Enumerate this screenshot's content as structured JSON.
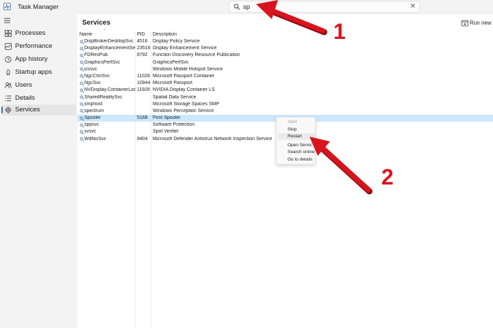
{
  "app": {
    "title": "Task Manager",
    "logo_icon": "task-manager-logo-icon"
  },
  "search": {
    "value": "sp",
    "icon": "search-icon",
    "clear_icon": "close-icon",
    "clear_glyph": "✕"
  },
  "sidebar": {
    "menu_icon": "hamburger-menu-icon",
    "items": [
      {
        "label": "Processes",
        "icon": "processes-icon",
        "active": false
      },
      {
        "label": "Performance",
        "icon": "performance-icon",
        "active": false
      },
      {
        "label": "App history",
        "icon": "app-history-icon",
        "active": false
      },
      {
        "label": "Startup apps",
        "icon": "startup-apps-icon",
        "active": false
      },
      {
        "label": "Users",
        "icon": "users-icon",
        "active": false
      },
      {
        "label": "Details",
        "icon": "details-icon",
        "active": false
      },
      {
        "label": "Services",
        "icon": "services-icon",
        "active": true
      }
    ]
  },
  "main": {
    "title": "Services",
    "run_new_label": "Run new t",
    "run_new_icon": "run-new-task-icon",
    "columns": {
      "name": "Name",
      "pid": "PID",
      "description": "Description"
    },
    "sort_glyph": "^",
    "rows": [
      {
        "name": "DispBrokerDesktopSvc",
        "pid": "4516",
        "description": "Display Policy Service"
      },
      {
        "name": "DisplayEnhancementSer...",
        "pid": "23516",
        "description": "Display Enhancement Service"
      },
      {
        "name": "FDResPub",
        "pid": "8792",
        "description": "Function Discovery Resource Publication"
      },
      {
        "name": "GraphicsPerfSvc",
        "pid": "",
        "description": "GraphicsPerfSvc"
      },
      {
        "name": "icssvc",
        "pid": "",
        "description": "Windows Mobile Hotspot Service"
      },
      {
        "name": "NgcCtnrSvc",
        "pid": "11028",
        "description": "Microsoft Passport Container"
      },
      {
        "name": "NgcSvc",
        "pid": "10944",
        "description": "Microsoft Passport"
      },
      {
        "name": "NVDisplay.ContainerLoc...",
        "pid": "11928",
        "description": "NVIDIA Display Container LS"
      },
      {
        "name": "SharedRealitySvc",
        "pid": "",
        "description": "Spatial Data Service"
      },
      {
        "name": "smphost",
        "pid": "",
        "description": "Microsoft Storage Spaces SMP"
      },
      {
        "name": "spectrum",
        "pid": "",
        "description": "Windows Perception Service"
      },
      {
        "name": "Spooler",
        "pid": "5168",
        "description": "Print Spooler",
        "selected": true
      },
      {
        "name": "sppsvc",
        "pid": "",
        "description": "Software Protection"
      },
      {
        "name": "svsvc",
        "pid": "",
        "description": "Spot Verifier"
      },
      {
        "name": "WdNisSvc",
        "pid": "9404",
        "description": "Microsoft Defender Antivirus Network Inspection Service"
      }
    ]
  },
  "context_menu": {
    "items": [
      {
        "label": "Start",
        "disabled": true
      },
      {
        "label": "Stop",
        "disabled": false
      },
      {
        "label": "Restart",
        "disabled": false,
        "hover": true
      },
      {
        "label": "Open Servic",
        "disabled": false
      },
      {
        "label": "Search online",
        "disabled": false
      },
      {
        "label": "Go to details",
        "disabled": false
      }
    ]
  },
  "annotations": [
    {
      "label": "1",
      "color": "#d9141c"
    },
    {
      "label": "2",
      "color": "#d9141c"
    }
  ],
  "colors": {
    "accent": "#3a6ea5",
    "selection": "#cce8ff",
    "annotation": "#d9141c"
  }
}
